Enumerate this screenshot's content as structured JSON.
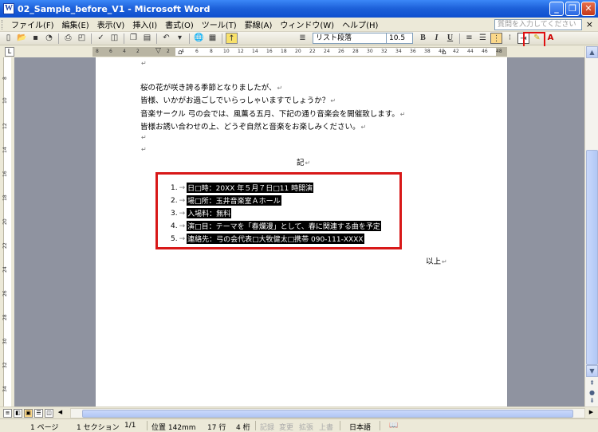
{
  "window": {
    "title": "02_Sample_before_V1 - Microsoft Word",
    "app_icon": "W",
    "minimize": "_",
    "maximize": "❐",
    "close": "✕"
  },
  "menubar": {
    "items": [
      "ファイル(F)",
      "編集(E)",
      "表示(V)",
      "挿入(I)",
      "書式(O)",
      "ツール(T)",
      "罫線(A)",
      "ウィンドウ(W)",
      "ヘルプ(H)"
    ],
    "help_placeholder": "質問を入力してください",
    "close": "×"
  },
  "toolbar": {
    "style_value": "リスト段落",
    "font_size": "10.5",
    "bold": "B",
    "italic": "I",
    "underline": "U",
    "font_color": "A"
  },
  "ruler": {
    "ticks": [
      "8",
      "6",
      "4",
      "2",
      "2",
      "4",
      "6",
      "8",
      "10",
      "12",
      "14",
      "16",
      "18",
      "20",
      "22",
      "24",
      "26",
      "28",
      "30",
      "32",
      "34",
      "36",
      "38",
      "40",
      "42",
      "44",
      "46",
      "48"
    ],
    "vticks": [
      "8",
      "10",
      "12",
      "14",
      "16",
      "18",
      "20",
      "22",
      "24",
      "26",
      "28",
      "30",
      "32",
      "34"
    ]
  },
  "document": {
    "para_mark": "↵",
    "lines": [
      "桜の花が咲き誇る季節となりましたが、",
      "皆様、いかがお過ごしでいらっしゃいますでしょうか？",
      "音楽サークル 弓の会では、風薫る五月、下記の通り音楽会を開催致します。",
      "皆様お誘い合わせの上、どうぞ自然と音楽をお楽しみください。"
    ],
    "ki": "記",
    "list": [
      {
        "num": "1.",
        "text": "日□時：20XX 年５月７日□11 時開演"
      },
      {
        "num": "2.",
        "text": "場□所：玉井音楽室Ａホール"
      },
      {
        "num": "3.",
        "text": "入場料：無料"
      },
      {
        "num": "4.",
        "text": "演□目：テーマを「春爛漫」として、春に関連する曲を予定"
      },
      {
        "num": "5.",
        "text": "連絡先：弓の会代表□大牧健太□携帯 090-111-XXXX"
      }
    ],
    "list_arrow": "→",
    "closing": "以上"
  },
  "statusbar": {
    "page": "1 ページ",
    "section": "1 セクション",
    "pages": "1/1",
    "position": "位置 142mm",
    "line": "17 行",
    "column": "4 桁",
    "rec": "記録",
    "trk": "変更",
    "ext": "拡張",
    "ovr": "上書",
    "lang": "日本語"
  }
}
